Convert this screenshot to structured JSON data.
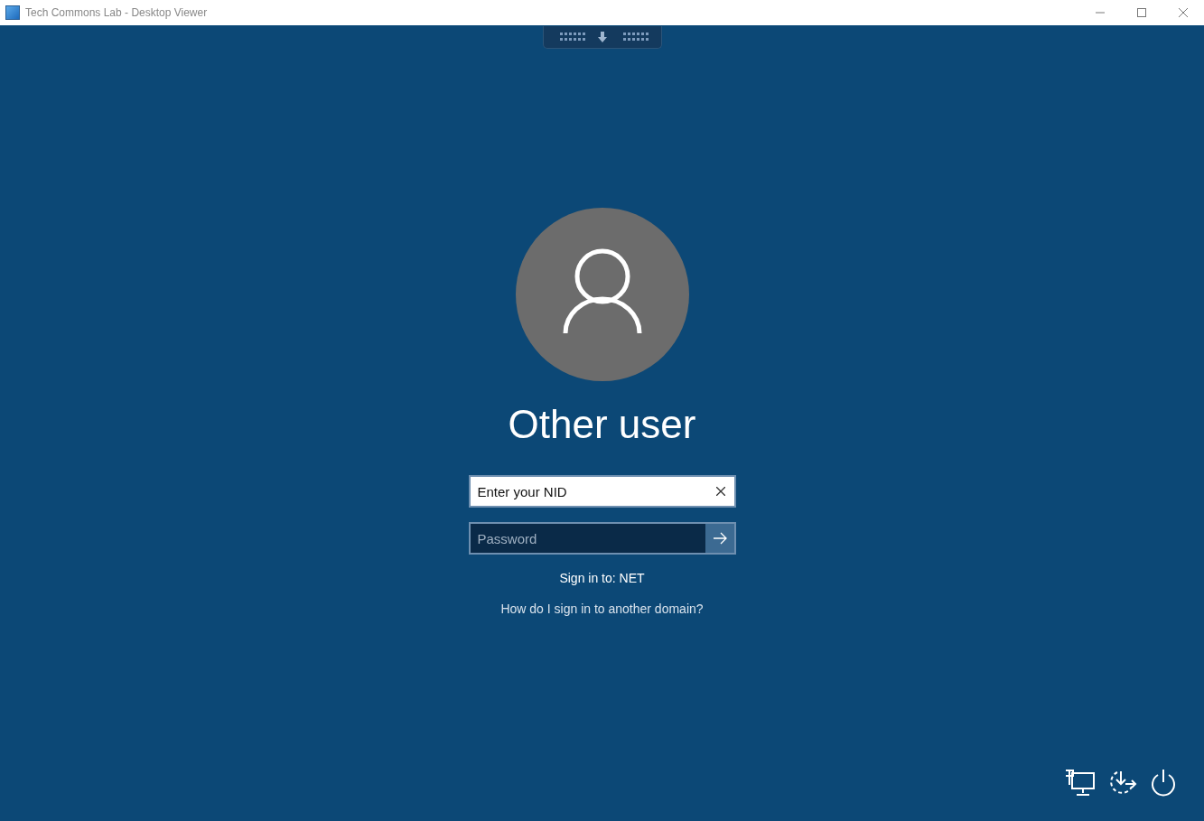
{
  "window": {
    "title": "Tech Commons Lab - Desktop Viewer"
  },
  "user": {
    "name": "Other user"
  },
  "username_field": {
    "value": "Enter your NID"
  },
  "password_field": {
    "placeholder": "Password"
  },
  "sign_in_to": "Sign in to: NET",
  "help_link": "How do I sign in to another domain?"
}
